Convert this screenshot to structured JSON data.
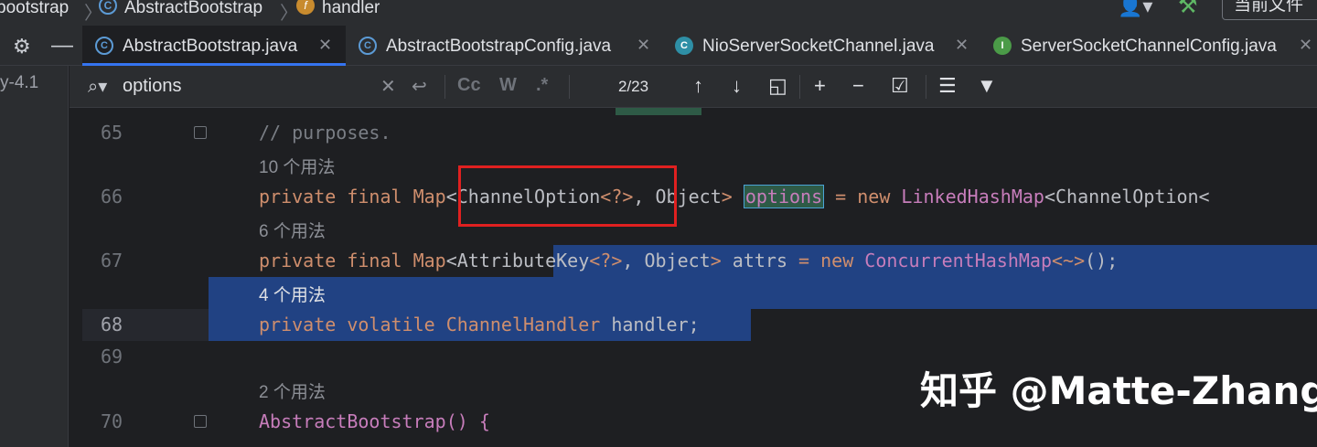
{
  "breadcrumb": {
    "items": [
      "bootstrap",
      "AbstractBootstrap",
      "handler"
    ]
  },
  "header": {
    "scope_label": "当前文件"
  },
  "tabs": [
    {
      "label": "AbstractBootstrap.java",
      "icon": "class-lock-icon",
      "active": true
    },
    {
      "label": "AbstractBootstrapConfig.java",
      "icon": "class-lock-icon",
      "active": false
    },
    {
      "label": "NioServerSocketChannel.java",
      "icon": "class-icon",
      "active": false
    },
    {
      "label": "ServerSocketChannelConfig.java",
      "icon": "interface-icon",
      "active": false
    }
  ],
  "left_panel": {
    "text": "y-4.1"
  },
  "find": {
    "query": "options",
    "match_count": "2/23",
    "case_label": "Cc",
    "word_label": "W",
    "regex_label": ".*"
  },
  "editor": {
    "lines": [
      {
        "number": "65",
        "code": "// purposes."
      },
      {
        "hint": "10 个用法"
      },
      {
        "number": "66",
        "code": "private final Map<ChannelOption<?>, Object> options = new LinkedHashMap<ChannelOption<"
      },
      {
        "hint": "6 个用法"
      },
      {
        "number": "67",
        "code": "private final Map<AttributeKey<?>, Object> attrs = new ConcurrentHashMap<~>();"
      },
      {
        "hint": "4 个用法"
      },
      {
        "number": "68",
        "code": "private volatile ChannelHandler handler;"
      },
      {
        "number": "69",
        "code": ""
      },
      {
        "hint": "2 个用法"
      },
      {
        "number": "70",
        "code": "AbstractBootstrap() {"
      }
    ]
  },
  "watermark": "知乎 @Matte-Zhang",
  "colors": {
    "accent": "#3574f0",
    "selection": "#214283",
    "keyword": "#cf8e6d",
    "field": "#c77dbb",
    "annotation_box": "#e02020"
  }
}
